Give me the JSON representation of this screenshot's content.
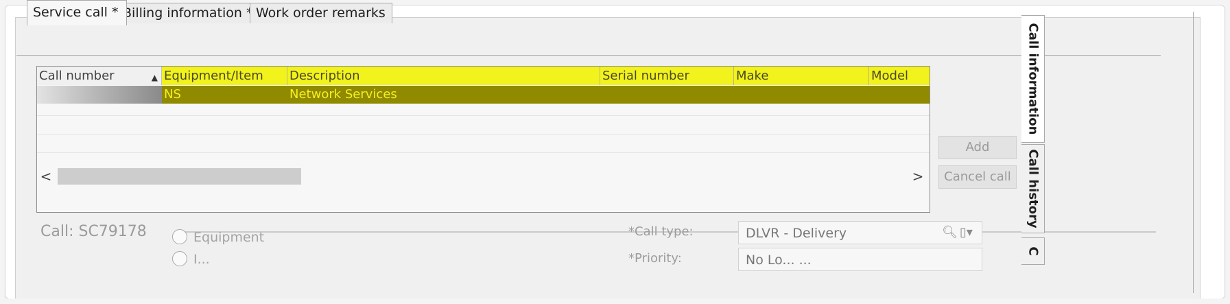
{
  "tabs": [
    {
      "label": "Service call *"
    },
    {
      "label": "Billing information  *"
    },
    {
      "label": "Work order remarks"
    }
  ],
  "side_tabs": [
    {
      "label": "Call information"
    },
    {
      "label": "Call history"
    },
    {
      "label": "C"
    }
  ],
  "grid": {
    "columns": [
      "Call number",
      "Equipment/Item",
      "Description",
      "Serial number",
      "Make",
      "Model"
    ],
    "sort_icon": "sort-up-arrow",
    "rows": [
      {
        "call_number": "",
        "equipment_item": "NS",
        "description": "Network Services",
        "serial_number": "",
        "make": "",
        "model": ""
      }
    ],
    "scroll_left": "<",
    "scroll_right": ">"
  },
  "buttons": {
    "add": "Add",
    "cancel_call": "Cancel call"
  },
  "call": {
    "label": "Call: SC79178"
  },
  "radio_options": [
    {
      "label": "Equipment"
    },
    {
      "label": "I..."
    }
  ],
  "fields": {
    "call_type_label": "*Call type:",
    "call_type_value": "DLVR - Delivery",
    "priority_label": "*Priority:",
    "priority_value": "No Lo... ..."
  },
  "colors": {
    "header_yellow": "#f2f21c",
    "selected_row_bg": "#8f8a00",
    "selected_row_text": "#f5f020"
  }
}
